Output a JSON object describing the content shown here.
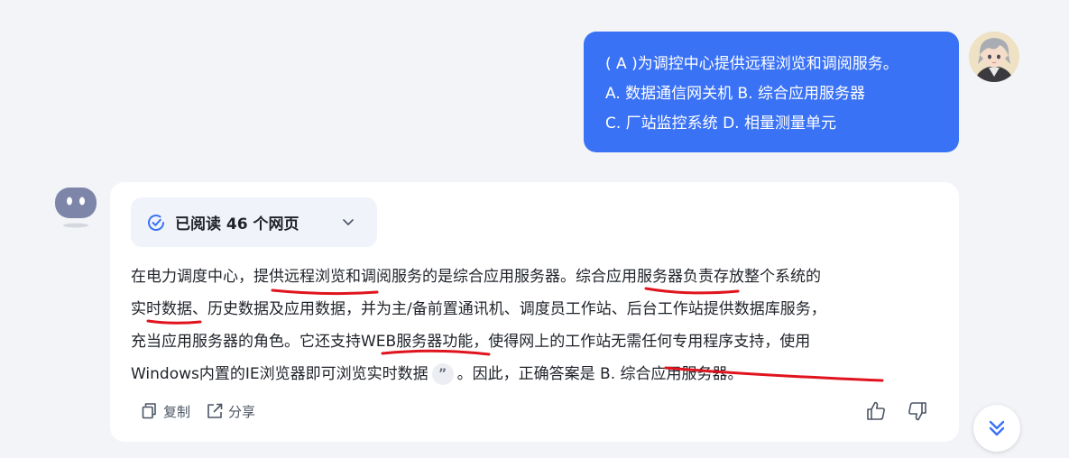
{
  "user_message": {
    "lines": [
      "( A )为调控中心提供远程浏览和调阅服务。",
      "A. 数据通信网关机 B. 综合应用服务器",
      "C. 厂站监控系统 D. 相量测量单元"
    ]
  },
  "assistant": {
    "read_status": "已阅读 46 个网页",
    "answer": {
      "line1": "在电力调度中心，提供远程浏览和调阅服务的是综合应用服务器。综合应用服务器负责存放整个系统的",
      "line2": "实时数据、历史数据及应用数据，并为主/备前置通讯机、调度员工作站、后台工作站提供数据库服务，",
      "line3": "充当应用服务器的角色。它还支持WEB服务器功能，使得网上的工作站无需任何专用程序支持，使用",
      "line4_start": "Windows内置的IE浏览器即可浏览实时数据",
      "quote_glyph": "”",
      "line4_end": "。因此，正确答案是 B. 综合应用服务器。"
    },
    "actions": {
      "copy_label": "复制",
      "share_label": "分享"
    }
  },
  "colors": {
    "user_bubble": "#3a72f5",
    "page_background": "#f3f4f8",
    "annotation_red": "#e0141e",
    "accent": "#3a72f5"
  },
  "icons": [
    "check-circle-icon",
    "chevron-down-icon",
    "copy-icon",
    "share-icon",
    "thumbs-up-icon",
    "thumbs-down-icon",
    "double-chevron-down-icon",
    "bot-avatar-icon",
    "user-avatar"
  ]
}
